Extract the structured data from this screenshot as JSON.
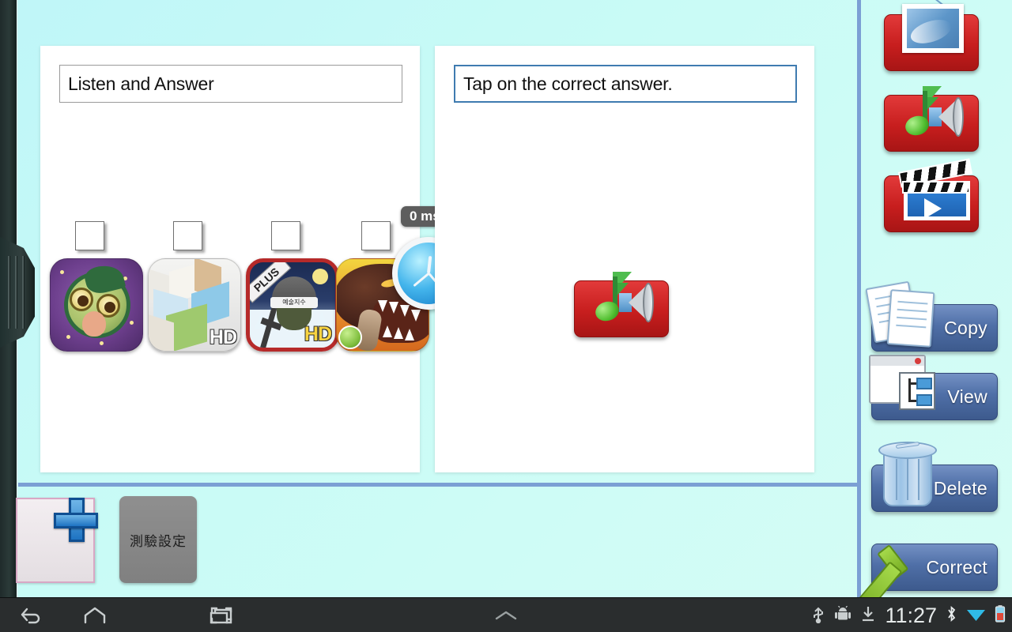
{
  "app": {
    "left_panel": {
      "title": "Listen and Answer",
      "checkbox_count": 4,
      "app_icons": [
        {
          "name": "owl-game-icon",
          "label": ""
        },
        {
          "name": "blocks-hd-game-icon",
          "label": "HD"
        },
        {
          "name": "soldier-hd-game-icon",
          "label": "HD",
          "ribbon": "PLUS",
          "band_text": "예술지수"
        },
        {
          "name": "monster-game-icon",
          "label": ""
        }
      ],
      "timer": {
        "badge": "0 ms",
        "icon": "clock-icon"
      }
    },
    "right_panel": {
      "title": "Tap on the correct answer.",
      "media": {
        "icon": "audio-icon"
      }
    },
    "sidebar": {
      "media_buttons": [
        {
          "name": "insert-picture-button",
          "icon": "picture-icon"
        },
        {
          "name": "insert-audio-button",
          "icon": "audio-icon"
        },
        {
          "name": "insert-video-button",
          "icon": "video-icon"
        }
      ],
      "action_buttons": [
        {
          "name": "copy-button",
          "label": "Copy",
          "icon": "copy-icon"
        },
        {
          "name": "view-button",
          "label": "View",
          "icon": "view-icon"
        },
        {
          "name": "delete-button",
          "label": "Delete",
          "icon": "trash-icon"
        },
        {
          "name": "correct-button",
          "label": "Correct",
          "icon": "checkmark-icon"
        }
      ]
    },
    "toolbar": {
      "new_slide_label": "",
      "quiz_settings_label": "測驗設定"
    },
    "navbar": {
      "back": "back-icon",
      "home": "home-icon",
      "recents": "recent-apps-icon",
      "screenshot": "screenshot-icon",
      "expand": "chevron-up-icon",
      "status": {
        "usb": "usb-icon",
        "android": "android-icon",
        "download": "download-icon",
        "time": "11:27",
        "bluetooth": "bluetooth-icon",
        "wifi": "wifi-icon",
        "battery": "battery-icon"
      }
    },
    "colors": {
      "background": "#c9fbf6",
      "divider": "#7b9fd4",
      "accent_red": "#c71e1e",
      "accent_blue": "#4f6fa7",
      "navbar": "#2a2d2e"
    }
  }
}
